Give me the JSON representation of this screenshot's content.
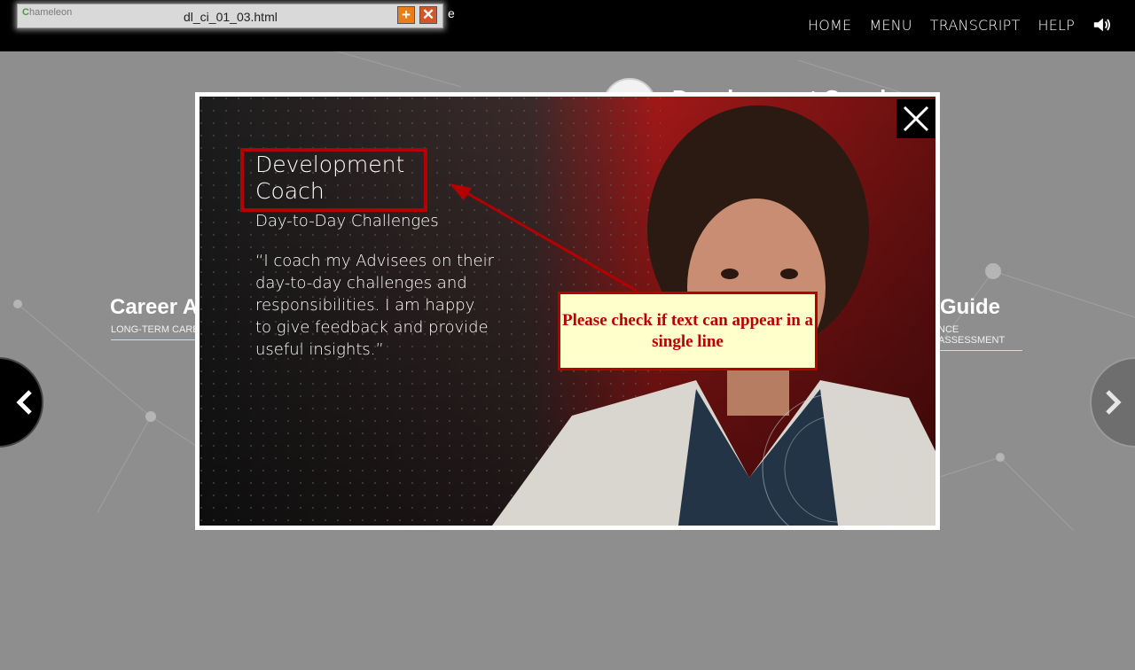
{
  "toolbar": {
    "filename": "dl_ci_01_03.html",
    "logo_text": "hameleon",
    "tail_text": "e"
  },
  "nav": {
    "items": [
      "HOME",
      "MENU",
      "TRANSCRIPT",
      "HELP"
    ]
  },
  "background": {
    "left_title": "Career A",
    "left_sub": "LONG-TERM CARE",
    "right_title": "Guide",
    "right_sub": "NCE ASSESSMENT"
  },
  "modal": {
    "title": "Development Coach",
    "subtitle": "Day-to-Day Challenges",
    "quote": "“I coach my Advisees on their day-to-day challenges and responsibilities. I am happy to give feedback and provide useful insights.”"
  },
  "annotation": {
    "text": "Please check if text can appear in a single line"
  },
  "colors": {
    "accent_red": "#b40000",
    "callout_bg": "#ffffcc",
    "topbar": "#000000"
  }
}
